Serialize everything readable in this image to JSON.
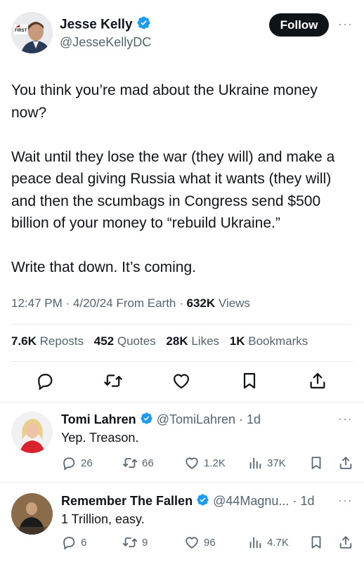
{
  "author": {
    "name": "Jesse Kelly",
    "handle": "@JesseKellyDC",
    "avatar_badge": "FIRST"
  },
  "follow_label": "Follow",
  "more_label": "···",
  "tweet": {
    "text": "You think you’re mad about the Ukraine money now?\n\nWait until they lose the war (they will) and make a peace deal giving Russia what it wants (they will) and then the scumbags in Congress send $500 billion of your money to “rebuild Ukraine.”\n\nWrite that down. It’s coming.",
    "time": "12:47 PM",
    "date": "4/20/24",
    "source": "From Earth",
    "views_count": "632K",
    "views_label": "Views"
  },
  "stats": {
    "reposts_count": "7.6K",
    "reposts_label": "Reposts",
    "quotes_count": "452",
    "quotes_label": "Quotes",
    "likes_count": "28K",
    "likes_label": "Likes",
    "bookmarks_count": "1K",
    "bookmarks_label": "Bookmarks"
  },
  "icons": [
    "reply-icon",
    "repost-icon",
    "like-icon",
    "bookmark-icon",
    "share-icon",
    "verified-badge-icon",
    "views-chart-icon"
  ],
  "colors": {
    "verified": "#1d9bf0",
    "text": "#0f1419",
    "muted": "#536471",
    "button": "#0f1419"
  },
  "replies": [
    {
      "name": "Tomi Lahren",
      "handle": "@TomiLahren",
      "age": "1d",
      "text": "Yep. Treason.",
      "reply_count": "26",
      "repost_count": "66",
      "like_count": "1.2K",
      "view_count": "37K"
    },
    {
      "name": "Remember The Fallen",
      "handle": "@44Magnu...",
      "age": "1d",
      "text": "1 Trillion, easy.",
      "reply_count": "6",
      "repost_count": "9",
      "like_count": "96",
      "view_count": "4.7K"
    }
  ]
}
